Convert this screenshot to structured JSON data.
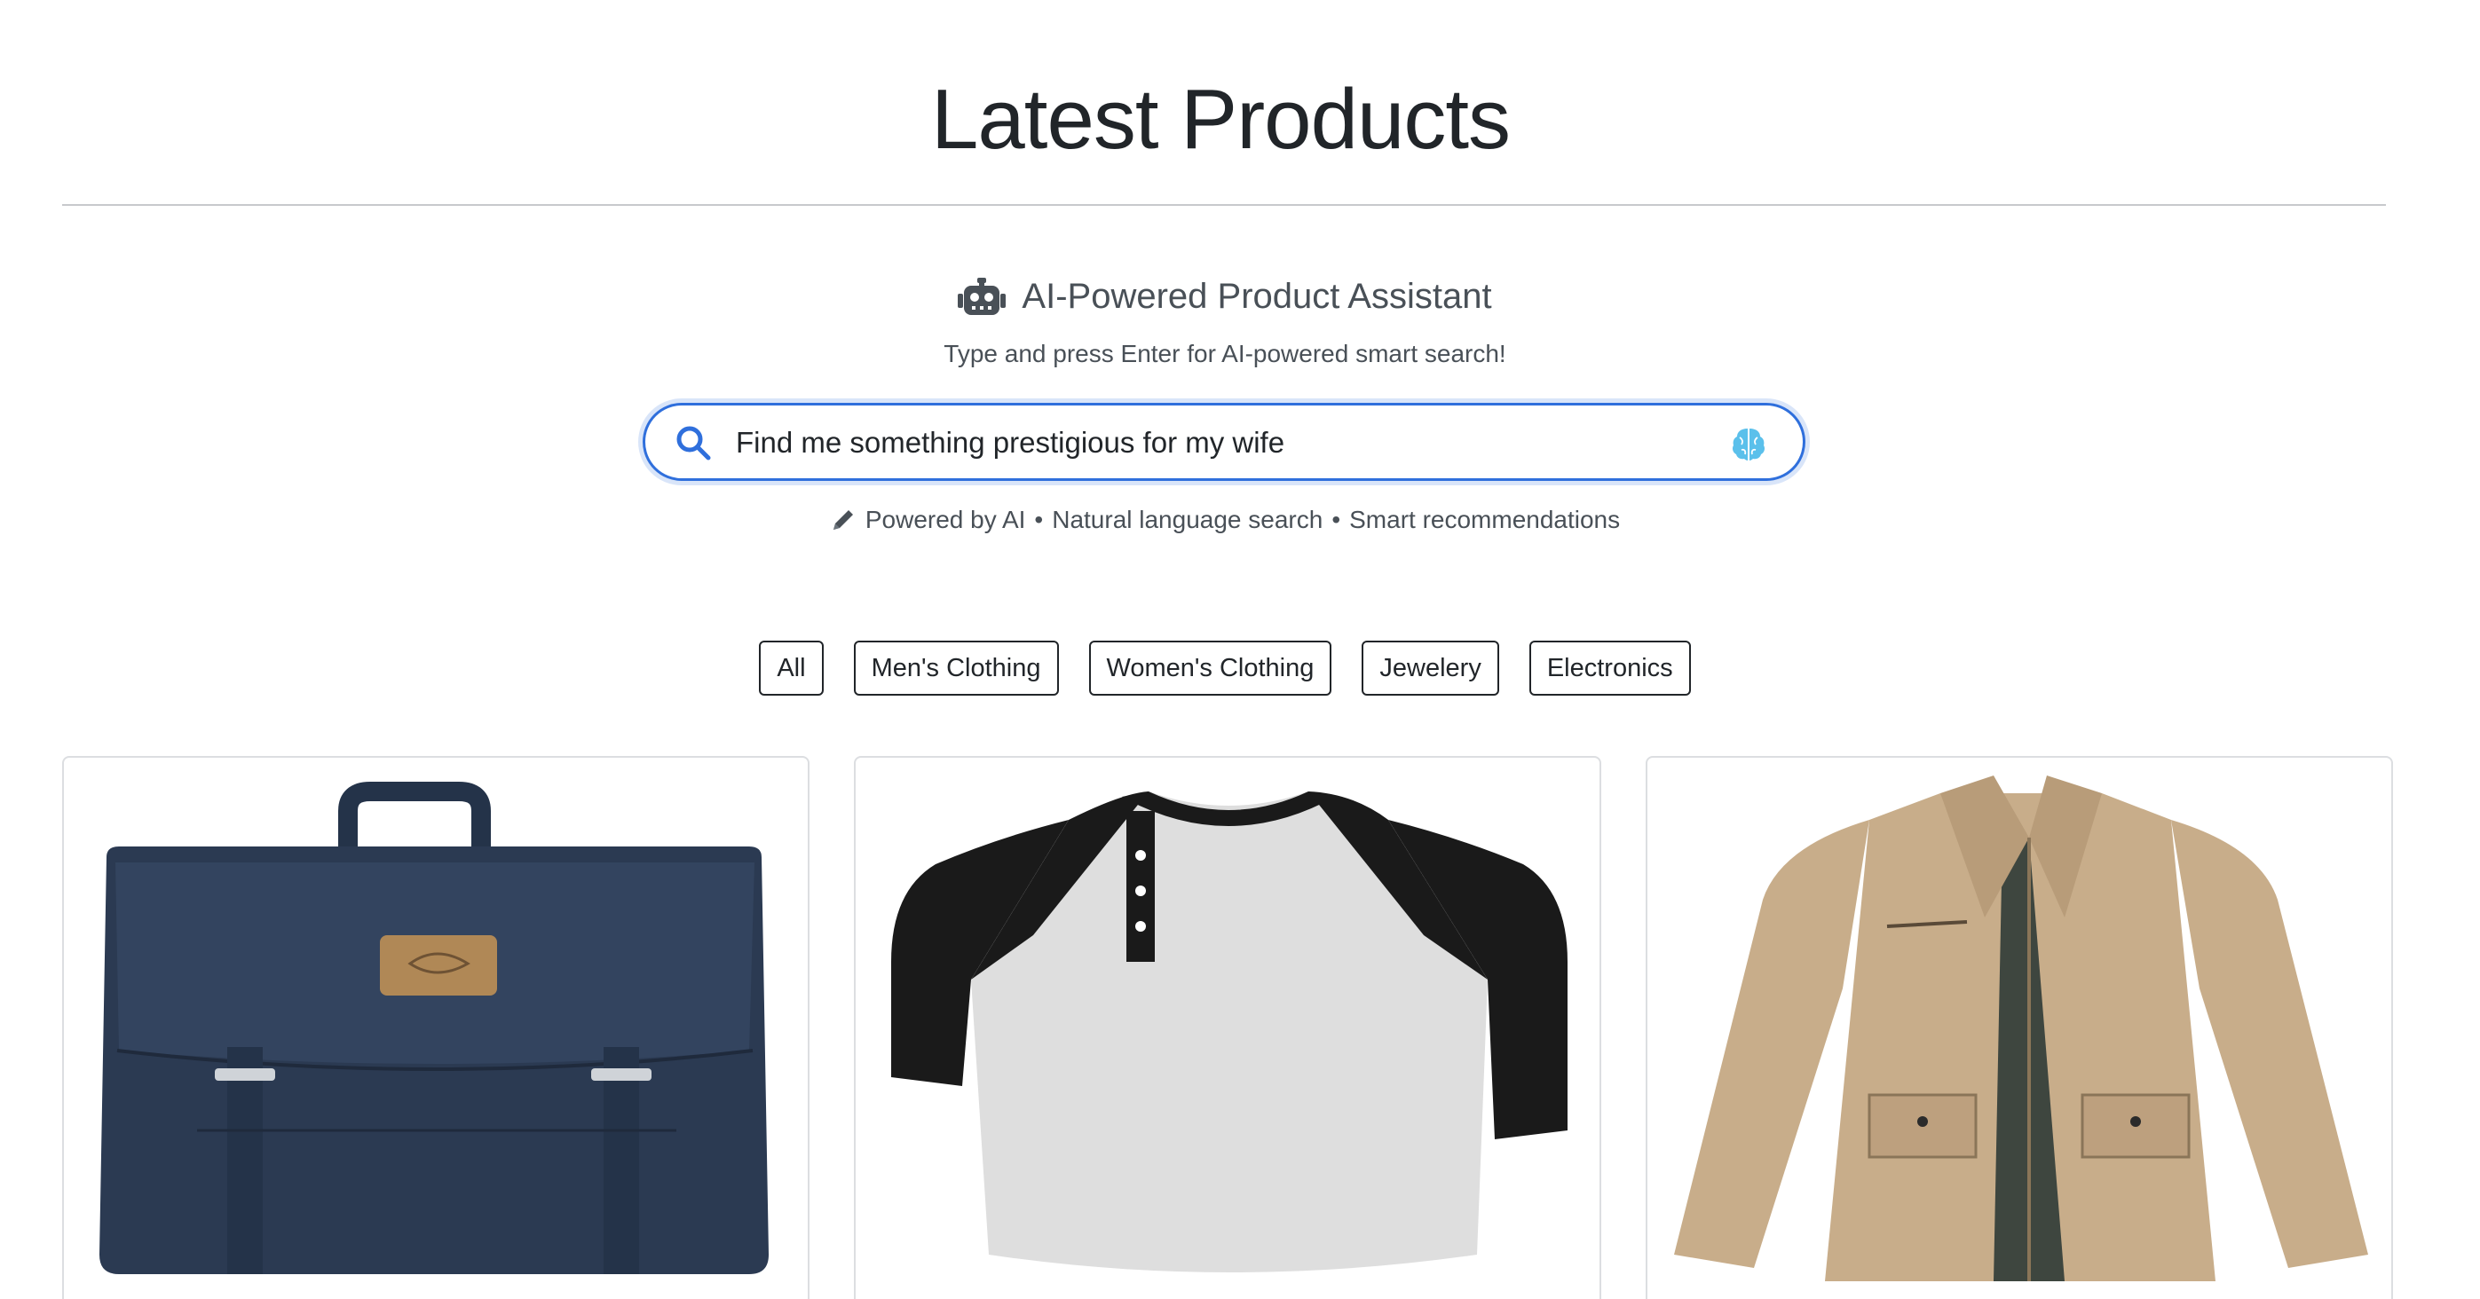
{
  "page": {
    "title": "Latest Products"
  },
  "assistant": {
    "title": "AI-Powered Product Assistant",
    "subtitle": "Type and press Enter for AI-powered smart search!",
    "icon": "robot-icon"
  },
  "search": {
    "value": "Find me something prestigious for my wife",
    "icon": "search-icon",
    "ai_icon": "brain-icon",
    "accent": "#2f6fdc"
  },
  "features": {
    "icon": "pencil-icon",
    "powered": "Powered by AI",
    "natural": "Natural language search",
    "smart": "Smart recommendations",
    "separator": "•"
  },
  "filters": [
    "All",
    "Men's Clothing",
    "Women's Clothing",
    "Jewelery",
    "Electronics"
  ],
  "products": [
    {
      "image": "navy-messenger-backpack",
      "color": "#2b3a52"
    },
    {
      "image": "raglan-henley-shirt",
      "color": "#1a1a1a"
    },
    {
      "image": "khaki-cotton-jacket",
      "color": "#c8ad8a"
    }
  ]
}
